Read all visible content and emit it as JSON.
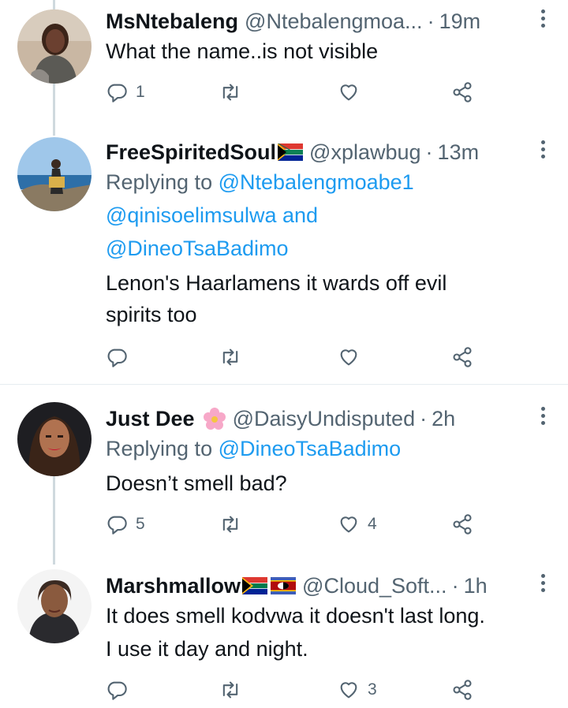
{
  "tweets": [
    {
      "name": "MsNtebaleng",
      "handle": "@Ntebalengmoa...",
      "separator": "·",
      "time": "19m",
      "lines": [
        "What the name..is not visible"
      ],
      "reply_count": "1",
      "like_count": ""
    },
    {
      "name": "FreeSpiritedSoul",
      "handle": "@xplawbug",
      "separator": "·",
      "time": "13m",
      "reply_prefix": "Replying to",
      "mention1": "@Ntebalengmoabe1",
      "mention2": "@qinisoelimsulwa",
      "and_word": "and",
      "mention3": "@DineoTsaBadimo",
      "lines": [
        "Lenon's Haarlamens it wards off evil",
        "spirits too"
      ],
      "reply_count": "",
      "like_count": ""
    },
    {
      "name": "Just Dee",
      "handle": "@DaisyUndisputed",
      "separator": "·",
      "time": "2h",
      "reply_prefix": "Replying to",
      "mention1": "@DineoTsaBadimo",
      "lines": [
        "Doesn’t smell bad?"
      ],
      "reply_count": "5",
      "like_count": "4"
    },
    {
      "name": "Marshmallow",
      "handle": "@Cloud_Soft...",
      "separator": "·",
      "time": "1h",
      "lines": [
        "It does smell kodvwa it doesn't last long.",
        "I use it day and night."
      ],
      "reply_count": "",
      "like_count": "3"
    }
  ],
  "icons": {
    "reply": "reply-icon",
    "retweet": "retweet-icon",
    "like": "heart-icon",
    "share": "share-icon",
    "more": "more-icon"
  },
  "colors": {
    "link": "#1d9bf0",
    "secondary": "#536471",
    "thread_line": "#cfd9de"
  }
}
